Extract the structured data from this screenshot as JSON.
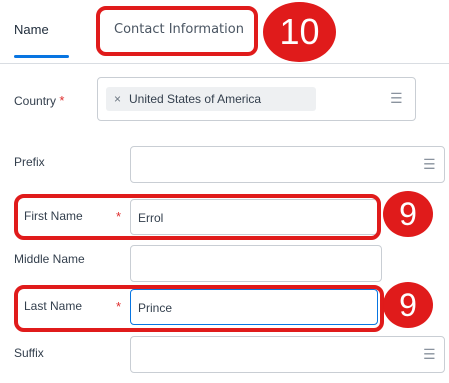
{
  "tabs": {
    "name_label": "Name",
    "contact_label": "Contact Information"
  },
  "steps": {
    "tab_step": "10",
    "first_name_step": "9",
    "last_name_step": "9"
  },
  "form": {
    "country": {
      "label": "Country",
      "required_mark": "*",
      "value": "United States of America",
      "remove_glyph": "×"
    },
    "prefix": {
      "label": "Prefix",
      "value": ""
    },
    "first_name": {
      "label": "First Name",
      "required_mark": "*",
      "value": "Errol"
    },
    "middle_name": {
      "label": "Middle Name",
      "value": ""
    },
    "last_name": {
      "label": "Last Name",
      "required_mark": "*",
      "value": "Prince"
    },
    "suffix": {
      "label": "Suffix",
      "value": ""
    }
  },
  "icons": {
    "list_icon": "prompt-list-icon",
    "remove_icon": "close-icon"
  },
  "colors": {
    "accent": "#0875e1",
    "highlight": "#e01b1b",
    "required": "#de2c2c"
  }
}
